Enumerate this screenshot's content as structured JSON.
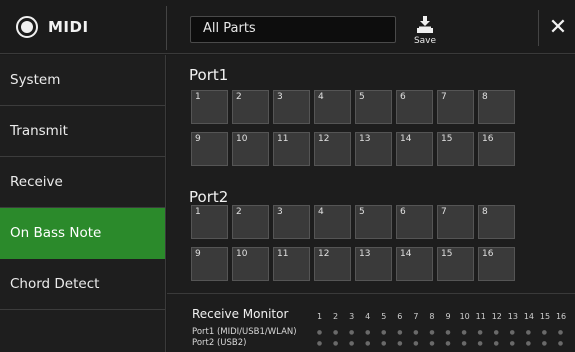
{
  "header": {
    "title": "MIDI",
    "parts_select": "All Parts",
    "save_label": "Save",
    "close_glyph": "✕"
  },
  "sidebar": {
    "items": [
      {
        "label": "System",
        "active": false
      },
      {
        "label": "Transmit",
        "active": false
      },
      {
        "label": "Receive",
        "active": false
      },
      {
        "label": "On Bass Note",
        "active": true
      },
      {
        "label": "Chord Detect",
        "active": false
      }
    ]
  },
  "main": {
    "port1": {
      "title": "Port1",
      "channels": [
        "1",
        "2",
        "3",
        "4",
        "5",
        "6",
        "7",
        "8",
        "9",
        "10",
        "11",
        "12",
        "13",
        "14",
        "15",
        "16"
      ]
    },
    "port2": {
      "title": "Port2",
      "channels": [
        "1",
        "2",
        "3",
        "4",
        "5",
        "6",
        "7",
        "8",
        "9",
        "10",
        "11",
        "12",
        "13",
        "14",
        "15",
        "16"
      ]
    },
    "monitor": {
      "title": "Receive Monitor",
      "channel_numbers": [
        "1",
        "2",
        "3",
        "4",
        "5",
        "6",
        "7",
        "8",
        "9",
        "10",
        "11",
        "12",
        "13",
        "14",
        "15",
        "16"
      ],
      "rows": [
        {
          "label": "Port1 (MIDI/USB1/WLAN)"
        },
        {
          "label": "Port2 (USB2)"
        }
      ]
    }
  },
  "colors": {
    "active_tab": "#2b8a2b",
    "background": "#1a1a1a",
    "cell": "#3a3a3a"
  },
  "icons": {
    "app": "midi-connector-icon",
    "save": "save-download-icon",
    "close": "close-icon"
  }
}
